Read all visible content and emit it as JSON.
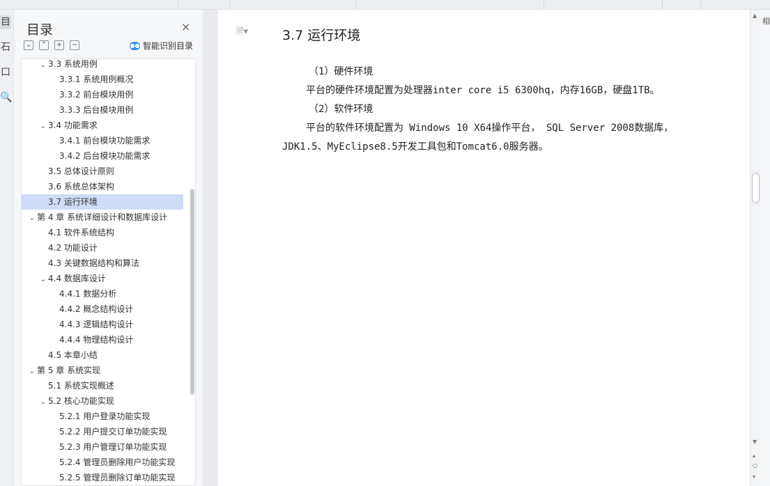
{
  "rail": {
    "items": [
      {
        "glyph": "目",
        "active": true
      },
      {
        "glyph": "石",
        "active": false
      },
      {
        "glyph": "口",
        "active": false
      },
      {
        "glyph": "🔍",
        "active": false
      }
    ]
  },
  "toc": {
    "title": "目录",
    "close": "×",
    "tools": [
      "⌄",
      "⌃",
      "+",
      "−"
    ],
    "smart_label": "智能识别目录",
    "items": [
      {
        "label": "3.3  系统用例",
        "level": 1,
        "caret": "⌄"
      },
      {
        "label": "3.3.1  系统用例概况",
        "level": 2
      },
      {
        "label": "3.3.2  前台模块用例",
        "level": 2
      },
      {
        "label": "3.3.3  后台模块用例",
        "level": 2
      },
      {
        "label": "3.4  功能需求",
        "level": 1,
        "caret": "⌄"
      },
      {
        "label": "3.4.1  前台模块功能需求",
        "level": 2
      },
      {
        "label": "3.4.2  后台模块功能需求",
        "level": 2
      },
      {
        "label": "3.5  总体设计原则",
        "level": 1
      },
      {
        "label": "3.6  系统总体架构",
        "level": 1
      },
      {
        "label": "3.7  运行环境",
        "level": 1,
        "selected": true
      },
      {
        "label": "第 4 章    系统详细设计和数据库设计",
        "level": 0,
        "caret": "⌄"
      },
      {
        "label": "4.1  软件系统结构",
        "level": 1
      },
      {
        "label": "4.2  功能设计",
        "level": 1
      },
      {
        "label": "4.3  关键数据结构和算法",
        "level": 1
      },
      {
        "label": "4.4  数据库设计",
        "level": 1,
        "caret": "⌄"
      },
      {
        "label": "4.4.1  数据分析",
        "level": 2
      },
      {
        "label": "4.4.2  概念结构设计",
        "level": 2
      },
      {
        "label": "4.4.3  逻辑结构设计",
        "level": 2
      },
      {
        "label": "4.4.4  物理结构设计",
        "level": 2
      },
      {
        "label": "4.5  本章小结",
        "level": 1
      },
      {
        "label": "第 5 章    系统实现",
        "level": 0,
        "caret": "⌄"
      },
      {
        "label": "5.1  系统实现概述",
        "level": 1
      },
      {
        "label": "5.2  核心功能实现",
        "level": 1,
        "caret": "⌄"
      },
      {
        "label": "5.2.1  用户登录功能实现",
        "level": 2
      },
      {
        "label": "5.2.2  用户提交订单功能实现",
        "level": 2
      },
      {
        "label": "5.2.3  用户管理订单功能实现",
        "level": 2
      },
      {
        "label": "5.2.4  管理员删除用户功能实现",
        "level": 2
      },
      {
        "label": "5.2.5  管理员删除订单功能实现",
        "level": 2
      }
    ]
  },
  "document": {
    "heading": "3.7  运行环境",
    "page_menu_icon": "🗎▾",
    "paragraphs": [
      "（1）硬件环境",
      "平台的硬件环境配置为处理器inter core i5 6300hq，内存16GB，硬盘1TB。",
      "（2）软件环境",
      "平台的软件环境配置为 Windows 10 X64操作平台， SQL Server 2008数据库，",
      "JDK1.5、MyEclipse8.5开发工具包和Tomcat6.0服务器。"
    ]
  },
  "right_edge_glyph": "相"
}
